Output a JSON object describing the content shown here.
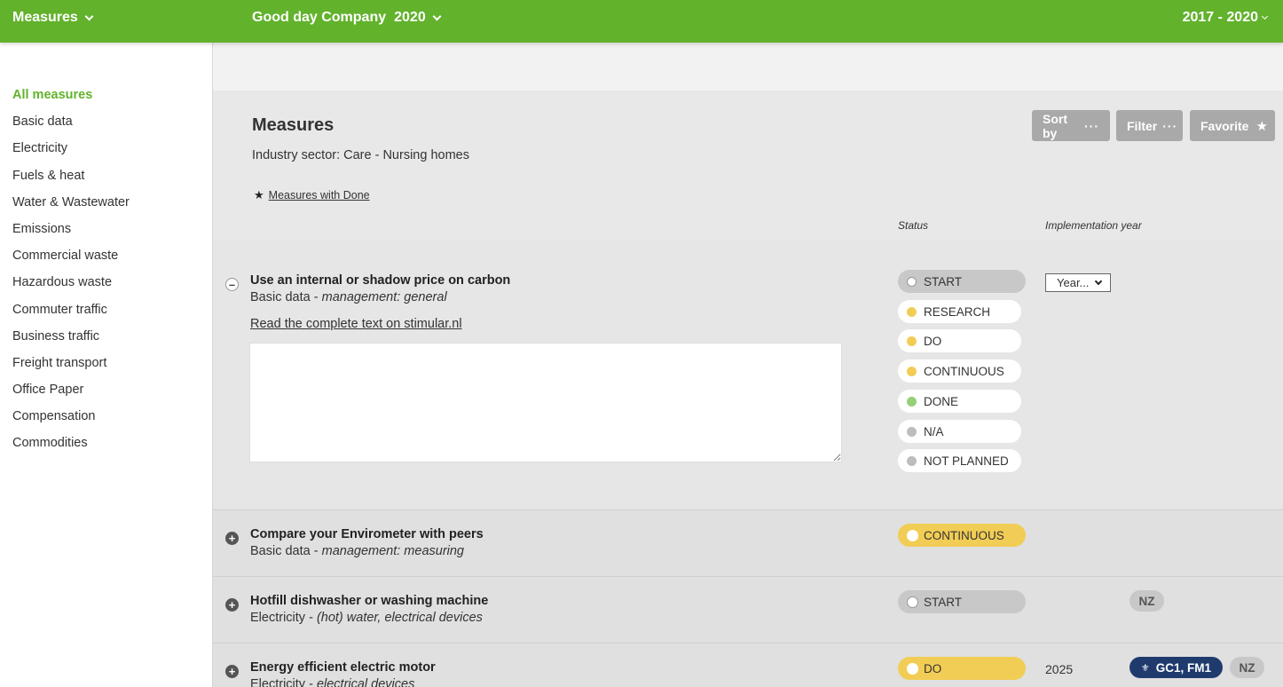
{
  "topbar": {
    "menu_label": "Measures",
    "company": "Good day Company",
    "year": "2020",
    "range": "2017 - 2020"
  },
  "sidebar": {
    "items": [
      {
        "label": "All measures",
        "active": true
      },
      {
        "label": "Basic data"
      },
      {
        "label": "Electricity"
      },
      {
        "label": "Fuels & heat"
      },
      {
        "label": "Water & Wastewater"
      },
      {
        "label": "Emissions"
      },
      {
        "label": "Commercial waste"
      },
      {
        "label": "Hazardous waste"
      },
      {
        "label": "Commuter traffic"
      },
      {
        "label": "Business traffic"
      },
      {
        "label": "Freight transport"
      },
      {
        "label": "Office Paper"
      },
      {
        "label": "Compensation"
      },
      {
        "label": "Commodities"
      }
    ]
  },
  "main": {
    "title": "Measures",
    "sector": "Industry sector: Care - Nursing homes",
    "done_link": "Measures with Done",
    "buttons": {
      "sort": "Sort by",
      "filter": "Filter",
      "favorite": "Favorite"
    },
    "col_status": "Status",
    "col_year": "Implementation year"
  },
  "measures": [
    {
      "title": "Use an internal or shadow price on carbon",
      "category": "Basic data",
      "subcategory": "management: general",
      "read_more": "Read the complete text on stimular.nl",
      "year_select": "Year...",
      "statuses": [
        "START",
        "RESEARCH",
        "DO",
        "CONTINUOUS",
        "DONE",
        "N/A",
        "NOT PLANNED"
      ]
    },
    {
      "title": "Compare your Envirometer with peers",
      "category": "Basic data",
      "subcategory": "management: measuring",
      "status": "CONTINUOUS"
    },
    {
      "title": "Hotfill dishwasher or washing machine",
      "category": "Electricity",
      "subcategory": "(hot) water, electrical devices",
      "status": "START",
      "tags": [
        "NZ"
      ]
    },
    {
      "title": "Energy efficient electric motor",
      "category": "Electricity",
      "subcategory": "electrical devices",
      "status": "DO",
      "year": "2025",
      "tags": [
        "GC1, FM1",
        "NZ"
      ]
    }
  ],
  "colors": {
    "brand_green": "#62b22c",
    "status_yellow": "#f2cd55",
    "status_green": "#95cf78",
    "gc_blue": "#1f3b6e"
  }
}
